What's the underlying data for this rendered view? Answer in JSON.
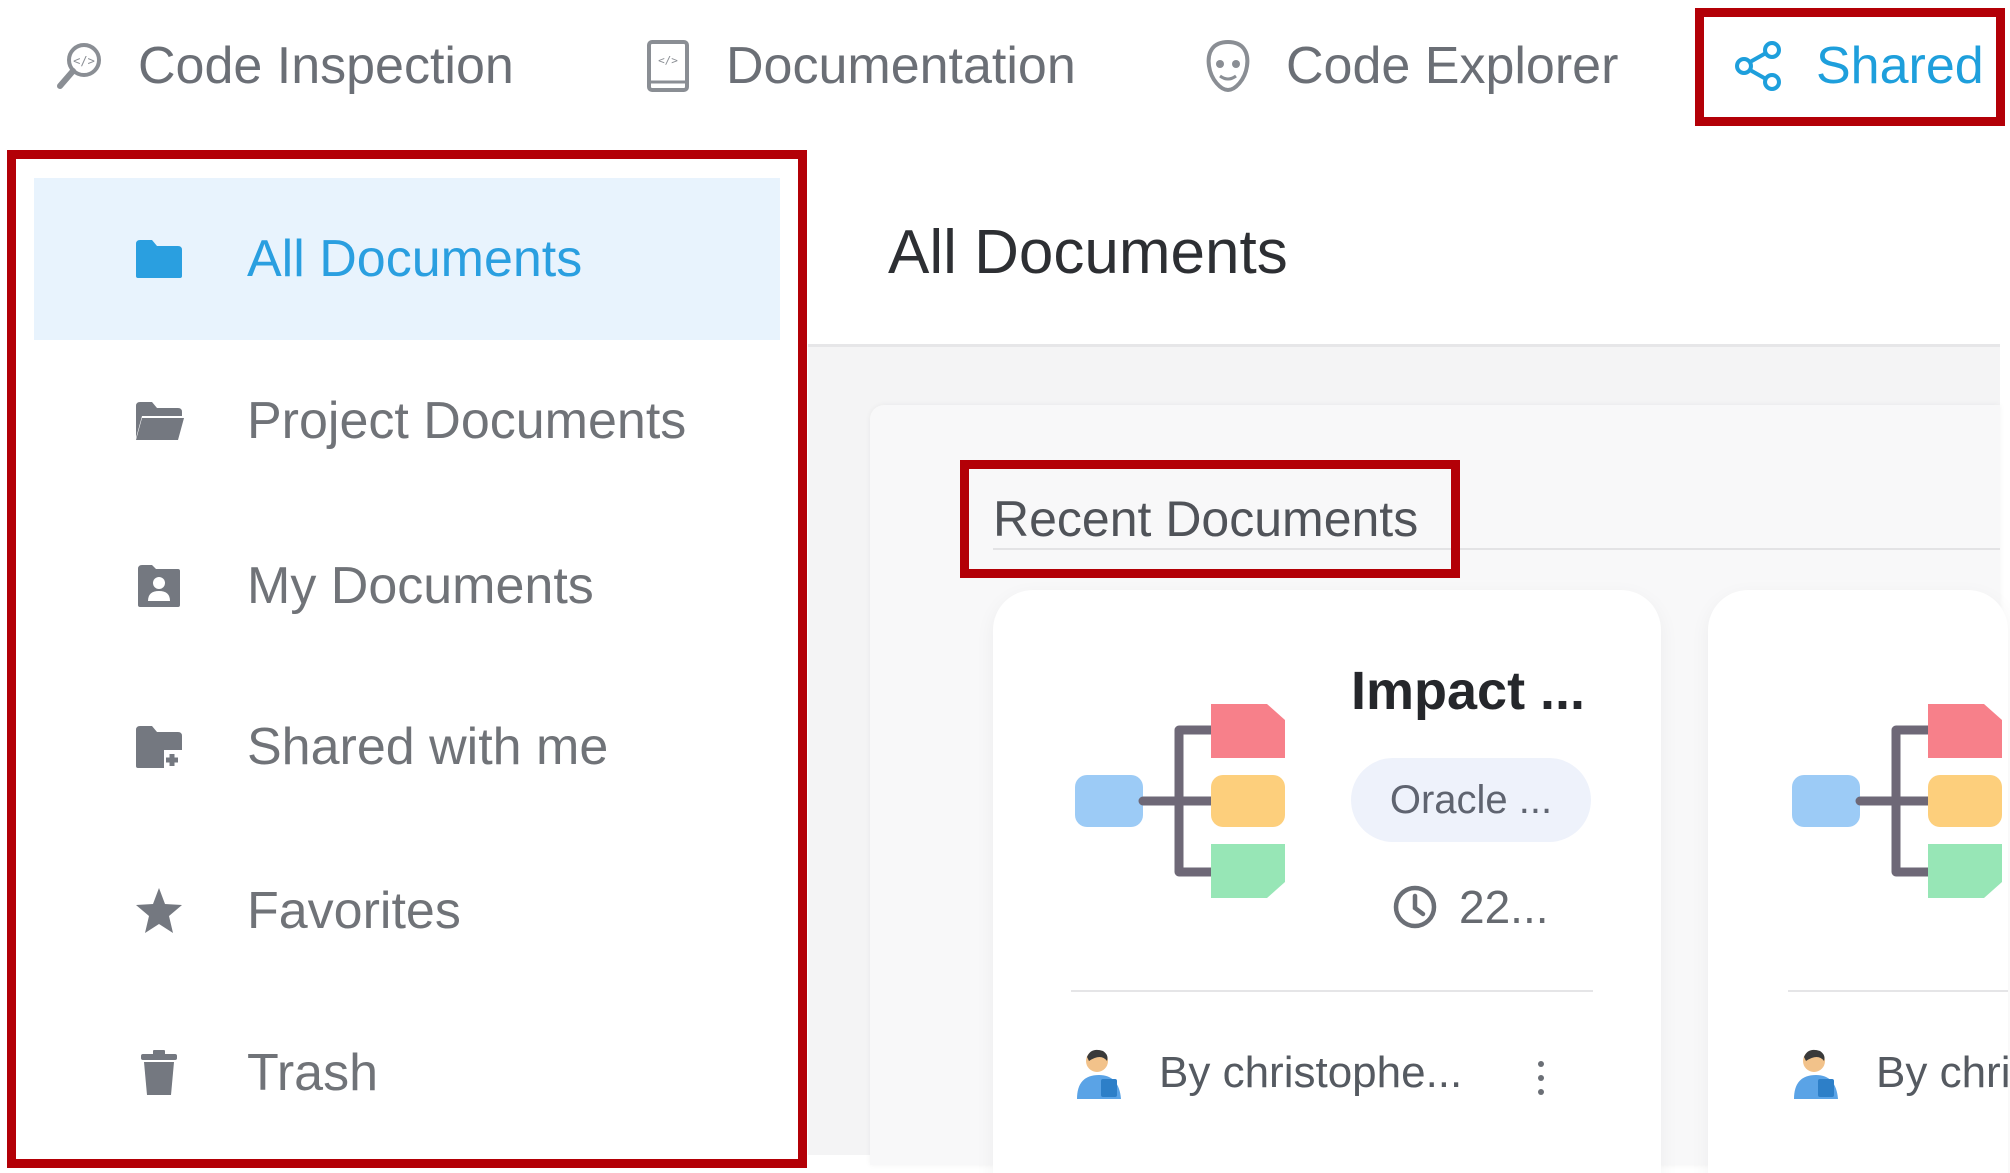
{
  "topnav": {
    "items": [
      {
        "label": "Code Inspection",
        "icon": "code-inspection-icon"
      },
      {
        "label": "Documentation",
        "icon": "documentation-book-icon"
      },
      {
        "label": "Code Explorer",
        "icon": "code-explorer-icon"
      },
      {
        "label": "Shared",
        "icon": "share-icon",
        "active": true
      }
    ]
  },
  "sidebar": {
    "items": [
      {
        "label": "All Documents",
        "icon": "folder-icon",
        "active": true
      },
      {
        "label": "Project Documents",
        "icon": "folder-open-icon"
      },
      {
        "label": "My Documents",
        "icon": "user-folder-icon"
      },
      {
        "label": "Shared with me",
        "icon": "shared-folder-icon"
      },
      {
        "label": "Favorites",
        "icon": "star-icon"
      },
      {
        "label": "Trash",
        "icon": "trash-icon"
      }
    ]
  },
  "main": {
    "title": "All Documents",
    "section_title": "Recent Documents",
    "cards": [
      {
        "title": "Impact ...",
        "chip": "Oracle ...",
        "time": "22...",
        "author": "By christophe..."
      },
      {
        "author": "By chri"
      }
    ]
  },
  "colors": {
    "accent": "#1e9fdc",
    "active_bg": "#e8f3fd",
    "annotation": "#b30007",
    "mindmap_red": "#f7808a",
    "mindmap_orange": "#fdcf7c",
    "mindmap_green": "#97e6b6",
    "mindmap_blue": "#9ccbf6"
  }
}
